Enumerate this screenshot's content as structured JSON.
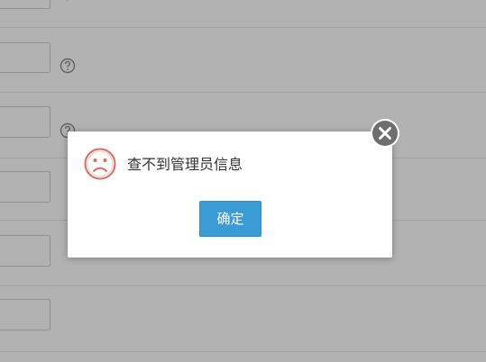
{
  "form": {
    "rows": [
      {
        "has_help": true
      },
      {
        "has_help": true
      },
      {
        "has_help": true
      },
      {
        "has_help": false
      },
      {
        "has_help": false
      },
      {
        "has_help": false
      }
    ]
  },
  "dialog": {
    "message": "查不到管理员信息",
    "confirm_label": "确定",
    "icon": "sad-face-icon",
    "close_icon": "close-icon"
  },
  "colors": {
    "overlay": "rgba(0,0,0,0.30)",
    "confirm_button": "#3a9bd5",
    "sad_face": "#e06a5a",
    "close_button": "#6e6e6e"
  }
}
